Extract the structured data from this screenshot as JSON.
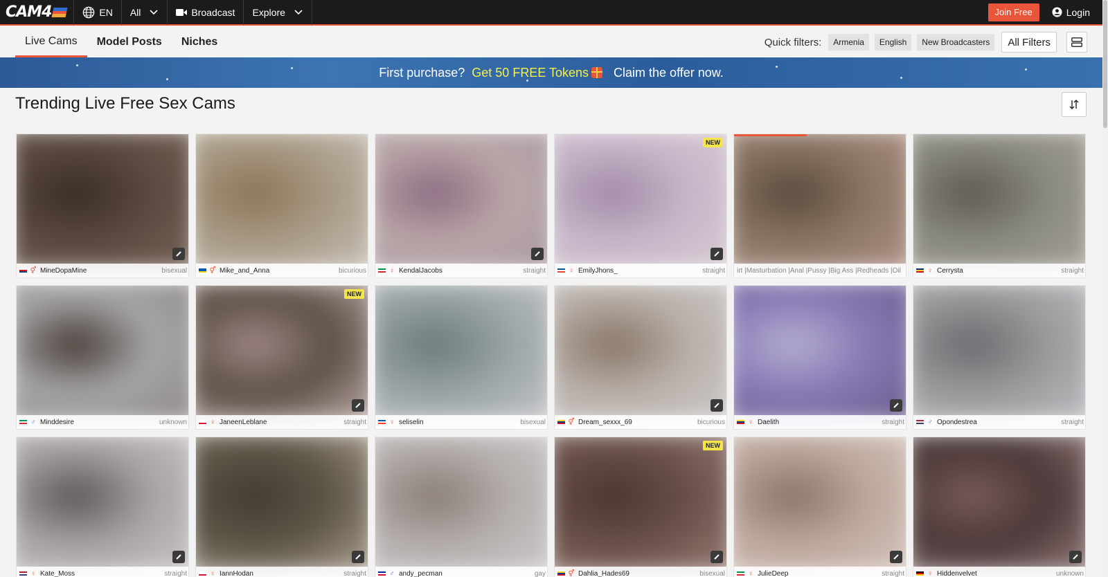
{
  "header": {
    "brand": "CAM4",
    "brand_colors": [
      "#2e6fd0",
      "#e8553a",
      "#f2a93b"
    ],
    "language": "EN",
    "gender_filter": "All",
    "broadcast": "Broadcast",
    "explore": "Explore",
    "join_label": "Join Free",
    "login_label": "Login",
    "accent_color": "#e8553a"
  },
  "subnav": {
    "tabs": [
      {
        "label": "Live Cams",
        "active": true
      },
      {
        "label": "Model Posts",
        "active": false
      },
      {
        "label": "Niches",
        "active": false
      }
    ],
    "quick_filters_label": "Quick filters:",
    "quick_filters": [
      "Armenia",
      "English",
      "New Broadcasters"
    ],
    "all_filters_label": "All Filters"
  },
  "banner": {
    "part1": "First purchase?",
    "highlight": "Get 50 FREE Tokens",
    "part2": "Claim the offer now."
  },
  "section_title": "Trending Live Free Sex Cams",
  "cards": [
    {
      "name": "MineDopaMine",
      "orientation": "bisexual",
      "gender": "couple",
      "flag": [
        "#ffffff",
        "#d7141a",
        "#11457e"
      ],
      "new": false,
      "edit": true,
      "tone": [
        "#5b4a40",
        "#3a2c26",
        "#7a6658"
      ]
    },
    {
      "name": "Mike_and_Anna",
      "orientation": "bicurious",
      "gender": "couple",
      "flag": [
        "#0057b7",
        "#0057b7",
        "#ffd700"
      ],
      "new": false,
      "edit": false,
      "tone": [
        "#a89a84",
        "#8a7658",
        "#c9c4bd"
      ]
    },
    {
      "name": "KendalJacobs",
      "orientation": "straight",
      "gender": "female",
      "flag": [
        "#009246",
        "#ffffff",
        "#ce2b37"
      ],
      "new": false,
      "edit": true,
      "tone": [
        "#b9a6a6",
        "#8c6c82",
        "#a998a4"
      ]
    },
    {
      "name": "EmilyJhons_",
      "orientation": "straight",
      "gender": "female",
      "flag": [
        "#0055a4",
        "#ffffff",
        "#ef4135"
      ],
      "new": true,
      "edit": true,
      "tone": [
        "#c7b6c9",
        "#a38aa8",
        "#d8cdd2"
      ]
    },
    {
      "name": "",
      "tags": "irt |Masturbation |Anal |Pussy |Big Ass |Redheads |Oil",
      "orientation": "",
      "gender": "",
      "flag": [],
      "new": false,
      "edit": false,
      "live": true,
      "tone": [
        "#8a7664",
        "#5a4a3c",
        "#b5948a"
      ]
    },
    {
      "name": "Cerrysta",
      "orientation": "straight",
      "gender": "female",
      "flag": [
        "#002b7f",
        "#fcd116",
        "#ce1126"
      ],
      "new": false,
      "edit": false,
      "tone": [
        "#8a8a80",
        "#5e5a52",
        "#a8a49a"
      ]
    },
    {
      "name": "Minddesire",
      "orientation": "unknown",
      "gender": "male",
      "flag": [
        "#009246",
        "#ffffff",
        "#ce2b37"
      ],
      "new": false,
      "edit": false,
      "tone": [
        "#a6a6a6",
        "#4a3f3a",
        "#8a8583"
      ]
    },
    {
      "name": "JaneenLeblane",
      "orientation": "straight",
      "gender": "female",
      "flag": [
        "#ffffff",
        "#ffffff",
        "#dc143c"
      ],
      "new": true,
      "edit": true,
      "tone": [
        "#5e5048",
        "#9c8684",
        "#c4b0ae"
      ]
    },
    {
      "name": "seliselin",
      "orientation": "bisexual",
      "gender": "female",
      "flag": [
        "#0055a4",
        "#ffffff",
        "#ef4135"
      ],
      "new": false,
      "edit": false,
      "tone": [
        "#9aa4a6",
        "#6e7a7a",
        "#c9c9cb"
      ]
    },
    {
      "name": "Dream_sexxx_69",
      "orientation": "bicurious",
      "gender": "couple",
      "flag": [
        "#fcd116",
        "#003893",
        "#ce1126"
      ],
      "new": false,
      "edit": true,
      "tone": [
        "#b8b0aa",
        "#8a7666",
        "#d0cccc"
      ]
    },
    {
      "name": "Daelith",
      "orientation": "straight",
      "gender": "female",
      "flag": [
        "#fcd116",
        "#003893",
        "#ce1126"
      ],
      "new": false,
      "edit": true,
      "tone": [
        "#8678b4",
        "#b5aed0",
        "#6a5a88"
      ]
    },
    {
      "name": "Opondestrea",
      "orientation": "straight",
      "gender": "male",
      "flag": [
        "#b22234",
        "#ffffff",
        "#3c3b6e"
      ],
      "new": false,
      "edit": false,
      "tone": [
        "#9a9a9c",
        "#6c6c70",
        "#c0c0c4"
      ]
    },
    {
      "name": "Kate_Moss",
      "orientation": "straight",
      "gender": "female",
      "flag": [
        "#b22234",
        "#ffffff",
        "#3c3b6e"
      ],
      "new": false,
      "edit": true,
      "tone": [
        "#a8a4a4",
        "#5c5856",
        "#cfc8c6"
      ]
    },
    {
      "name": "IannHodan",
      "orientation": "straight",
      "gender": "female",
      "flag": [
        "#ffffff",
        "#ffffff",
        "#dc143c"
      ],
      "new": false,
      "edit": true,
      "tone": [
        "#5e5646",
        "#433b30",
        "#b4a89a"
      ]
    },
    {
      "name": "andy_pecman",
      "orientation": "gay",
      "gender": "male",
      "flag": [
        "#00209f",
        "#ffffff",
        "#d21034"
      ],
      "new": false,
      "edit": false,
      "tone": [
        "#b4aeac",
        "#8a7e78",
        "#d0cccc"
      ]
    },
    {
      "name": "Dahlia_Hades69",
      "orientation": "bisexual",
      "gender": "couple",
      "flag": [
        "#fcd116",
        "#003893",
        "#ce1126"
      ],
      "new": true,
      "edit": true,
      "tone": [
        "#6a5048",
        "#4a3630",
        "#9c8078"
      ]
    },
    {
      "name": "JulieDeep",
      "orientation": "straight",
      "gender": "female",
      "flag": [
        "#009246",
        "#ffffff",
        "#ce2b37"
      ],
      "new": false,
      "edit": true,
      "tone": [
        "#bca89c",
        "#8c7466",
        "#d8c8c0"
      ]
    },
    {
      "name": "Hiddenvelvet",
      "orientation": "unknown",
      "gender": "female",
      "flag": [
        "#000000",
        "#dd0000",
        "#ffce00"
      ],
      "new": false,
      "edit": true,
      "tone": [
        "#4a3838",
        "#7a5a5a",
        "#9a8080"
      ]
    }
  ]
}
